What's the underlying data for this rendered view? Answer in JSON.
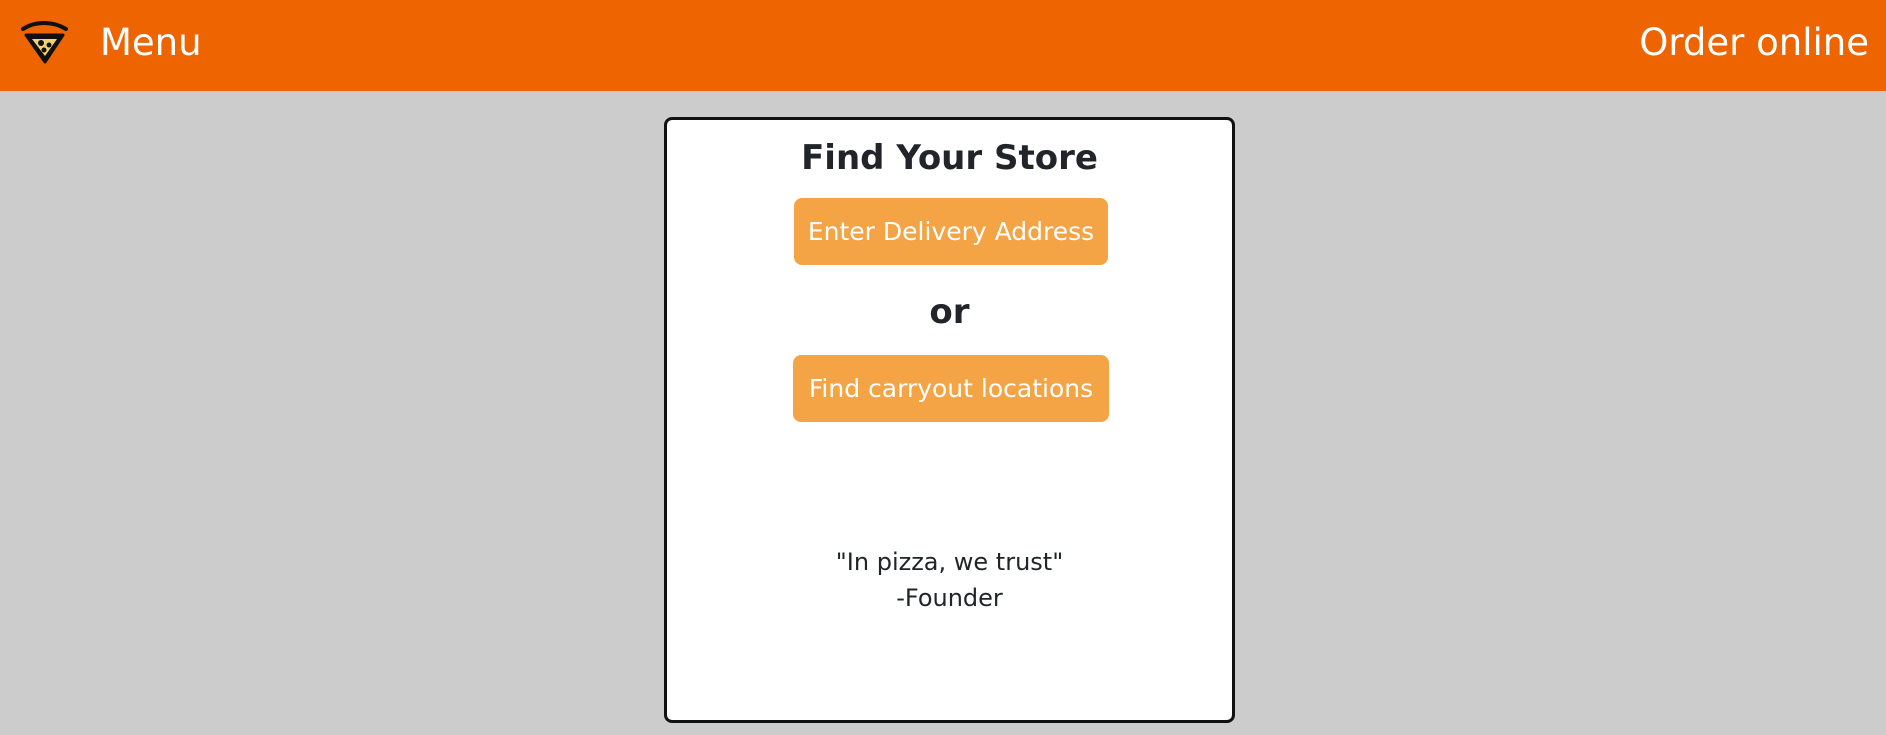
{
  "navbar": {
    "logo_icon": "pizza-slice-icon",
    "menu_label": "Menu",
    "order_label": "Order online",
    "background": "#ee6400",
    "text_color": "#ffffff"
  },
  "store_finder": {
    "title": "Find Your Store",
    "delivery_button_label": "Enter Delivery Address",
    "separator": "or",
    "carryout_button_label": "Find carryout locations",
    "button_color": "#f4a444"
  },
  "quote": {
    "text": "\"In pizza, we trust\"",
    "author": "-Founder"
  }
}
